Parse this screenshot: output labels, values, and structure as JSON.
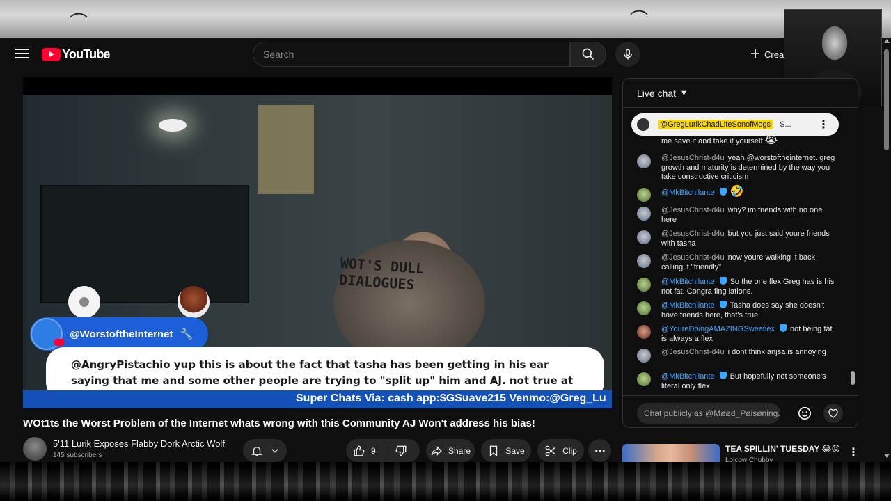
{
  "masthead": {
    "logo_text": "YouTube",
    "search_placeholder": "Search",
    "create_label": "Crea"
  },
  "player": {
    "shirt_text": "WOT'S DULL DIALOGUES",
    "overlay_name": "@WorstoftheInternet",
    "overlay_comment": "@AngryPistachio yup this is about the fact that tasha has been getting in his ear saying that me and some other people are trying to \"split up\" him and AJ. not true at all.",
    "ticker": "Super Chats Via: cash app:$GSuave215 Venmo:@Greg_Lu"
  },
  "video": {
    "title": "WOt1ts the Worst Problem of the Internet whats wrong with this Community AJ Won't address his bias!",
    "channel_name": "5'11 Lurik Exposes Flabby Dork Arctic Wolf",
    "subscribers": "145 subscribers",
    "like_count": "9",
    "share_label": "Share",
    "save_label": "Save",
    "clip_label": "Clip"
  },
  "chat": {
    "header": "Live chat",
    "pinned_name": "@GregLurikChadLiteSonofMogs",
    "pinned_text": "S...",
    "partial_top": "me save it and take it yourself",
    "messages": [
      {
        "author": "@JesusChrist-d4u",
        "text": "yeah @worstoftheinternet. greg growth and maturity is determined by the way you take constructive criticism",
        "member": false
      },
      {
        "author": "@MkBitchilante",
        "text": "🤣",
        "member": true
      },
      {
        "author": "@JesusChrist-d4u",
        "text": "why? im friends with no one here",
        "member": false
      },
      {
        "author": "@JesusChrist-d4u",
        "text": "but you just said youre friends with tasha",
        "member": false
      },
      {
        "author": "@JesusChrist-d4u",
        "text": "now youre walking it back calling it \"friendly\"",
        "member": false
      },
      {
        "author": "@MkBitchilante",
        "text": "So the one flex Greg has is his not fat. Congra fing lations.",
        "member": true
      },
      {
        "author": "@MkBitchilante",
        "text": "Tasha does say she doesn't have friends here, that's true",
        "member": true
      },
      {
        "author": "@YoureDoingAMAZINGSweetiex",
        "text": "not being fat is always a flex",
        "member": true
      },
      {
        "author": "@JesusChrist-d4u",
        "text": "i dont think anjsa is annoying",
        "member": false
      },
      {
        "author": "@MkBitchilante",
        "text": "But hopefully not someone's literal only flex",
        "member": true
      }
    ],
    "input_placeholder": "Chat publicly as @Møød_Pøisøning..."
  },
  "recommendation": {
    "title": "TEA SPILLIN' TUESDAY 😂😝",
    "channel": "Lolcow Chubby"
  }
}
